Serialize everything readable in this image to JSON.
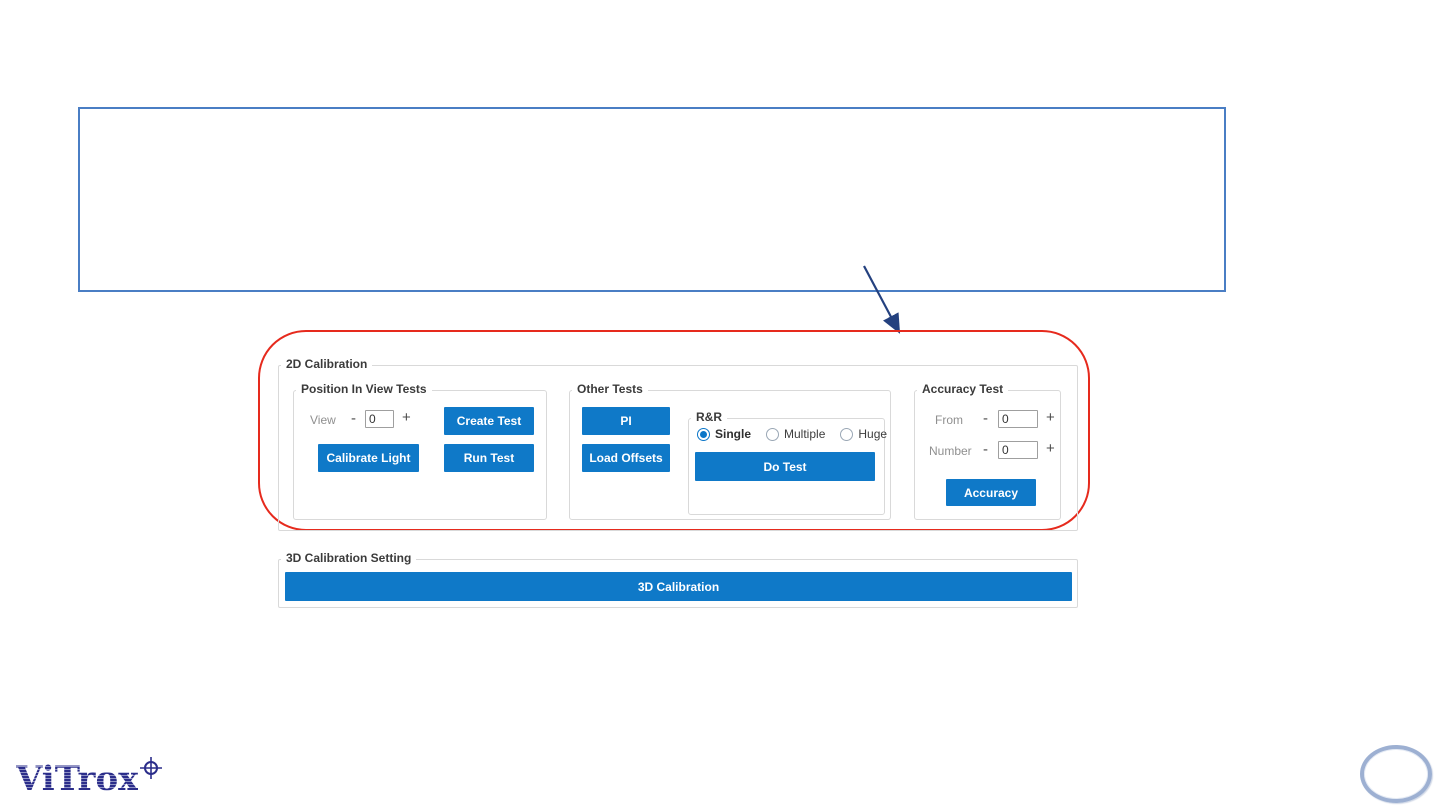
{
  "annotations": {
    "note_box": "",
    "arrow": "down-right-arrow",
    "highlight": "red-rounded-frame"
  },
  "groups": {
    "cal2d": {
      "title": "2D Calibration",
      "pos": {
        "title": "Position In View Tests",
        "view_label": "View",
        "view_value": "0",
        "create_test": "Create Test",
        "calibrate_light": "Calibrate Light",
        "run_test": "Run Test"
      },
      "other": {
        "title": "Other Tests",
        "pi": "PI",
        "load_offsets": "Load Offsets",
        "rnr": {
          "title": "R&R",
          "do_test": "Do Test",
          "selected": "Single",
          "options": [
            {
              "label": "Single",
              "selected": true
            },
            {
              "label": "Multiple",
              "selected": false
            },
            {
              "label": "Huge",
              "selected": false
            }
          ]
        }
      },
      "acc": {
        "title": "Accuracy Test",
        "from_label": "From",
        "from_value": "0",
        "number_label": "Number",
        "number_value": "0",
        "accuracy": "Accuracy"
      }
    },
    "cal3d": {
      "title": "3D Calibration Setting",
      "button": "3D Calibration"
    }
  },
  "steppers": {
    "minus": "-",
    "plus": "+"
  },
  "logo": {
    "text": "ViTrox",
    "icon": "crosshair-icon"
  },
  "colors": {
    "accent_blue": "#0f79c8",
    "annotation_red": "#e62a1d",
    "note_box_blue": "#4a7ec4",
    "arrow_navy": "#24417f",
    "logo_navy": "#2b2d8a",
    "ring_gray_blue": "#9db0d2",
    "group_border": "#d9d9d9",
    "radio_selected_blue": "#0b76c8"
  }
}
